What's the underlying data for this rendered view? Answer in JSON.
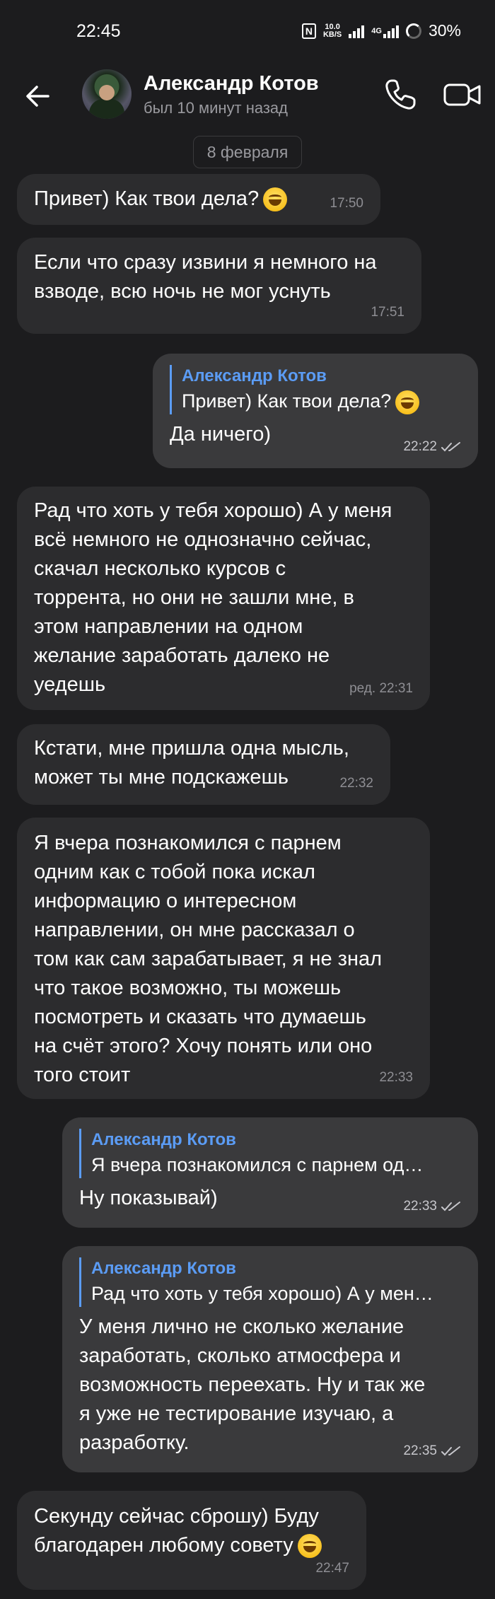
{
  "status_bar": {
    "time": "22:45",
    "nfc": "N",
    "net_speed_value": "10.0",
    "net_speed_unit": "KB/S",
    "network": "4G",
    "battery": "30%"
  },
  "header": {
    "contact_name": "Александр Котов",
    "contact_status": "был 10 минут назад"
  },
  "date_chip": "8 февраля",
  "messages": [
    {
      "dir": "in",
      "text": "Привет) Как твои дела?",
      "emoji": "grinning-face",
      "time": "17:50"
    },
    {
      "dir": "in",
      "text": "Если что сразу извини я немного на\nвзводе, всю ночь не мог уснуть",
      "time": "17:51"
    },
    {
      "dir": "out",
      "reply_name": "Александр Котов",
      "reply_text": "Привет) Как твои дела?",
      "reply_emoji": "grinning-face",
      "text": "Да ничего)",
      "time": "22:22"
    },
    {
      "dir": "in",
      "text": "Рад что хоть у тебя хорошо) А у меня\nвсё немного не однозначно сейчас,\nскачал несколько курсов с\nторрента, но они не зашли мне, в\nэтом направлении на одном\nжелание заработать далеко не\nуедешь",
      "time": "ред. 22:31"
    },
    {
      "dir": "in",
      "text": "Кстати, мне пришла одна мысль,\nможет ты мне подскажешь",
      "time": "22:32"
    },
    {
      "dir": "in",
      "text": "Я вчера познакомился с парнем\nодним как с тобой пока искал\nинформацию о интересном\nнаправлении, он мне рассказал о\nтом как сам зарабатывает, я не знал\nчто такое возможно, ты можешь\nпосмотреть и сказать что думаешь\nна счёт этого? Хочу понять или оно\nтого стоит",
      "time": "22:33"
    },
    {
      "dir": "out",
      "reply_name": "Александр Котов",
      "reply_text": "Я вчера познакомился с парнем од…",
      "text": "Ну показывай)",
      "time": "22:33"
    },
    {
      "dir": "out",
      "reply_name": "Александр Котов",
      "reply_text": "Рад что хоть у тебя хорошо) А у мен…",
      "text": "У меня лично не сколько желание\nзаработать, сколько атмосфера и\nвозможность переехать. Ну и так же\nя уже не тестирование изучаю, а\nразработку.",
      "time": "22:35"
    },
    {
      "dir": "in",
      "text": "Секунду сейчас сброшу) Буду\nблагодарен любому совету",
      "emoji": "smiling-face",
      "time": "22:47"
    }
  ],
  "colors": {
    "background": "#1c1c1e",
    "incoming_bubble": "#2c2c2e",
    "outgoing_bubble": "#3a3a3c",
    "reply_accent": "#5b9cf5"
  }
}
